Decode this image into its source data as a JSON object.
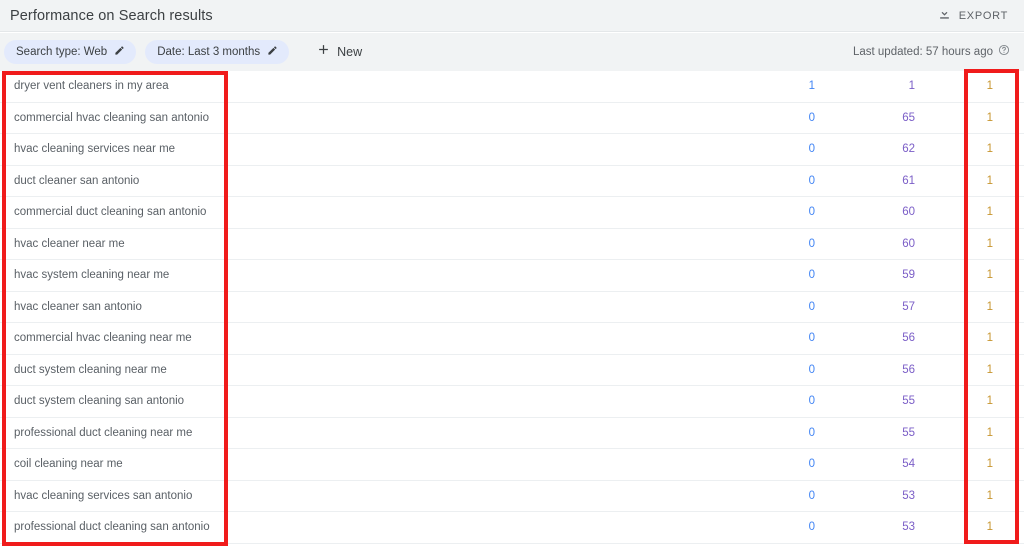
{
  "header": {
    "title": "Performance on Search results",
    "export_label": "EXPORT",
    "export_icon": "download-icon"
  },
  "filters": {
    "chips": [
      {
        "label": "Search type: Web",
        "edit_icon": "pencil-icon"
      },
      {
        "label": "Date: Last 3 months",
        "edit_icon": "pencil-icon"
      }
    ],
    "new_label": "New",
    "new_icon": "plus-icon",
    "last_updated": "Last updated: 57 hours ago",
    "help_icon": "help-circle-icon"
  },
  "colors": {
    "clicks": "#4285f4",
    "impressions": "#7b5ec7",
    "position": "#c7952e",
    "annotation": "#f01b1b",
    "chip_bg": "#e3eafc",
    "header_bg": "#f1f3f4"
  },
  "table": {
    "rows": [
      {
        "query": "dryer vent cleaners in my area",
        "clicks": "1",
        "impressions": "1",
        "position": "1"
      },
      {
        "query": "commercial hvac cleaning san antonio",
        "clicks": "0",
        "impressions": "65",
        "position": "1"
      },
      {
        "query": "hvac cleaning services near me",
        "clicks": "0",
        "impressions": "62",
        "position": "1"
      },
      {
        "query": "duct cleaner san antonio",
        "clicks": "0",
        "impressions": "61",
        "position": "1"
      },
      {
        "query": "commercial duct cleaning san antonio",
        "clicks": "0",
        "impressions": "60",
        "position": "1"
      },
      {
        "query": "hvac cleaner near me",
        "clicks": "0",
        "impressions": "60",
        "position": "1"
      },
      {
        "query": "hvac system cleaning near me",
        "clicks": "0",
        "impressions": "59",
        "position": "1"
      },
      {
        "query": "hvac cleaner san antonio",
        "clicks": "0",
        "impressions": "57",
        "position": "1"
      },
      {
        "query": "commercial hvac cleaning near me",
        "clicks": "0",
        "impressions": "56",
        "position": "1"
      },
      {
        "query": "duct system cleaning near me",
        "clicks": "0",
        "impressions": "56",
        "position": "1"
      },
      {
        "query": "duct system cleaning san antonio",
        "clicks": "0",
        "impressions": "55",
        "position": "1"
      },
      {
        "query": "professional duct cleaning near me",
        "clicks": "0",
        "impressions": "55",
        "position": "1"
      },
      {
        "query": "coil cleaning near me",
        "clicks": "0",
        "impressions": "54",
        "position": "1"
      },
      {
        "query": "hvac cleaning services san antonio",
        "clicks": "0",
        "impressions": "53",
        "position": "1"
      },
      {
        "query": "professional duct cleaning san antonio",
        "clicks": "0",
        "impressions": "53",
        "position": "1"
      }
    ]
  },
  "annotations": [
    {
      "name": "queries-column-highlight"
    },
    {
      "name": "position-column-highlight"
    }
  ]
}
